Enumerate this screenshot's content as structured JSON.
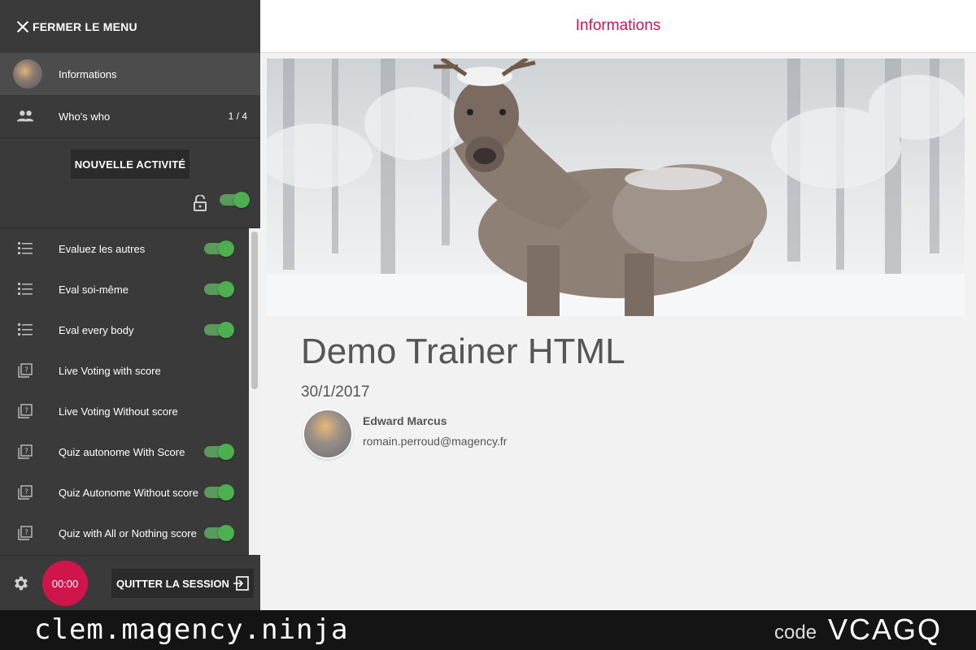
{
  "sidebar": {
    "close_label": "FERMER LE MENU",
    "nav": [
      {
        "label": "Informations"
      },
      {
        "label": "Who's who",
        "count": "1 / 4"
      }
    ],
    "new_activity_label": "NOUVELLE ACTIVITÉ",
    "activities": [
      {
        "label": "Evaluez les autres",
        "icon": "list-icon",
        "toggle": true
      },
      {
        "label": "Eval soi-même",
        "icon": "list-icon",
        "toggle": true
      },
      {
        "label": "Eval every body",
        "icon": "list-icon",
        "toggle": true
      },
      {
        "label": "Live Voting with score",
        "icon": "quiz-icon",
        "toggle": false
      },
      {
        "label": "Live Voting Without score",
        "icon": "quiz-icon",
        "toggle": false
      },
      {
        "label": "Quiz autonome With Score",
        "icon": "quiz-icon",
        "toggle": true
      },
      {
        "label": "Quiz Autonome Without score",
        "icon": "quiz-icon",
        "toggle": true
      },
      {
        "label": "Quiz with All or Nothing score",
        "icon": "quiz-icon",
        "toggle": true
      }
    ],
    "timer": "00:00",
    "quit_label": "QUITTER LA SESSION"
  },
  "header": {
    "title": "Informations"
  },
  "session": {
    "title": "Demo Trainer HTML",
    "date": "30/1/2017",
    "trainer_name": "Edward Marcus",
    "trainer_email": "romain.perroud@magency.fr"
  },
  "footer": {
    "site": "clem.magency.ninja",
    "code_label": "code",
    "code": "VCAGQ"
  },
  "colors": {
    "accent": "#c2185b",
    "timer": "#d0144c",
    "toggle_on": "#4caf50",
    "sidebar_bg": "#3a3a3a"
  }
}
